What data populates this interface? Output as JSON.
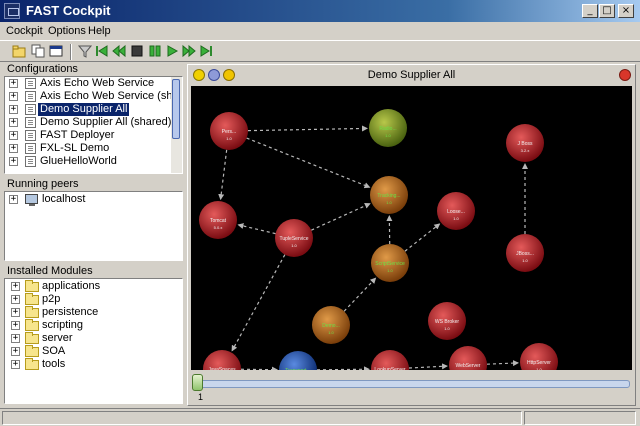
{
  "window": {
    "title": "FAST Cockpit",
    "minimize": "_",
    "maximize": "□",
    "close": "×"
  },
  "menu": [
    {
      "label": "Cockpit"
    },
    {
      "label": "Options"
    },
    {
      "label": "Help"
    }
  ],
  "toolbar": {
    "buttons": [
      {
        "icon": "open-folder-icon"
      },
      {
        "icon": "copy-icon"
      },
      {
        "icon": "window-icon"
      },
      {
        "icon": "filter-icon"
      },
      {
        "icon": "step-back-icon"
      },
      {
        "icon": "rewind-icon"
      },
      {
        "icon": "stop-icon"
      },
      {
        "icon": "pause-icon"
      },
      {
        "icon": "play-icon"
      },
      {
        "icon": "fast-forward-icon"
      },
      {
        "icon": "step-forward-icon"
      }
    ]
  },
  "configurations": {
    "title": "Configurations",
    "items": [
      {
        "label": "Axis Echo Web Service"
      },
      {
        "label": "Axis Echo Web Service (shared)"
      },
      {
        "label": "Demo Supplier All",
        "selected": true
      },
      {
        "label": "Demo Supplier All (shared)"
      },
      {
        "label": "FAST Deployer"
      },
      {
        "label": "FXL-SL Demo"
      },
      {
        "label": "GlueHelloWorld"
      }
    ]
  },
  "running_peers": {
    "title": "Running peers",
    "items": [
      {
        "label": "localhost"
      }
    ]
  },
  "installed_modules": {
    "title": "Installed Modules",
    "items": [
      {
        "label": "applications"
      },
      {
        "label": "p2p"
      },
      {
        "label": "persistence"
      },
      {
        "label": "scripting"
      },
      {
        "label": "server"
      },
      {
        "label": "SOA"
      },
      {
        "label": "tools"
      }
    ]
  },
  "graph": {
    "title": "Demo Supplier All",
    "zoom_label": "1",
    "colors": {
      "red": "#b0141e",
      "green": "#7a9a18",
      "orange": "#b86a18",
      "blue": "#1e4ea8",
      "text": "#f2f2f2",
      "green_text": "#6de046",
      "edge": "#b8b8b8"
    },
    "nodes": [
      {
        "id": "n1",
        "label": "Pers...",
        "version": "1.0",
        "color": "red"
      },
      {
        "id": "n2",
        "label": "Radio...",
        "version": "1.0",
        "color": "green"
      },
      {
        "id": "n3",
        "label": "J Boss",
        "version": "3.2.x",
        "color": "red"
      },
      {
        "id": "n4",
        "label": "Tomcat",
        "version": "5.0.x",
        "color": "red"
      },
      {
        "id": "n5",
        "label": "TupleService",
        "version": "1.0",
        "color": "red"
      },
      {
        "id": "n6",
        "label": "Tracking...",
        "version": "1.0",
        "color": "orange"
      },
      {
        "id": "n7",
        "label": "Loose...",
        "version": "1.0",
        "color": "red"
      },
      {
        "id": "n8",
        "label": "JBoss...",
        "version": "1.0",
        "color": "red"
      },
      {
        "id": "n9",
        "label": "ScriptService",
        "version": "1.0",
        "color": "orange"
      },
      {
        "id": "n10",
        "label": "Demo...",
        "version": "1.0",
        "color": "orange"
      },
      {
        "id": "n11",
        "label": "WS Broker",
        "version": "1.0",
        "color": "red"
      },
      {
        "id": "n12",
        "label": "JavaSpaces",
        "version": "1.2.x",
        "color": "red"
      },
      {
        "id": "n13",
        "label": "Transport...",
        "version": "1.0",
        "color": "blue"
      },
      {
        "id": "n14",
        "label": "LookupServer",
        "version": "1.0",
        "color": "red"
      },
      {
        "id": "n15",
        "label": "WebServer",
        "version": "1.0",
        "color": "red"
      },
      {
        "id": "n16",
        "label": "HttpServer",
        "version": "1.0",
        "color": "red"
      }
    ],
    "edges": [
      {
        "from": "n1",
        "to": "n2"
      },
      {
        "from": "n1",
        "to": "n6"
      },
      {
        "from": "n1",
        "to": "n4"
      },
      {
        "from": "n5",
        "to": "n4"
      },
      {
        "from": "n5",
        "to": "n6"
      },
      {
        "from": "n5",
        "to": "n12"
      },
      {
        "from": "n9",
        "to": "n6"
      },
      {
        "from": "n9",
        "to": "n7"
      },
      {
        "from": "n10",
        "to": "n9"
      },
      {
        "from": "n8",
        "to": "n3"
      },
      {
        "from": "n12",
        "to": "n13"
      },
      {
        "from": "n13",
        "to": "n14"
      },
      {
        "from": "n14",
        "to": "n15"
      },
      {
        "from": "n15",
        "to": "n16"
      }
    ]
  }
}
